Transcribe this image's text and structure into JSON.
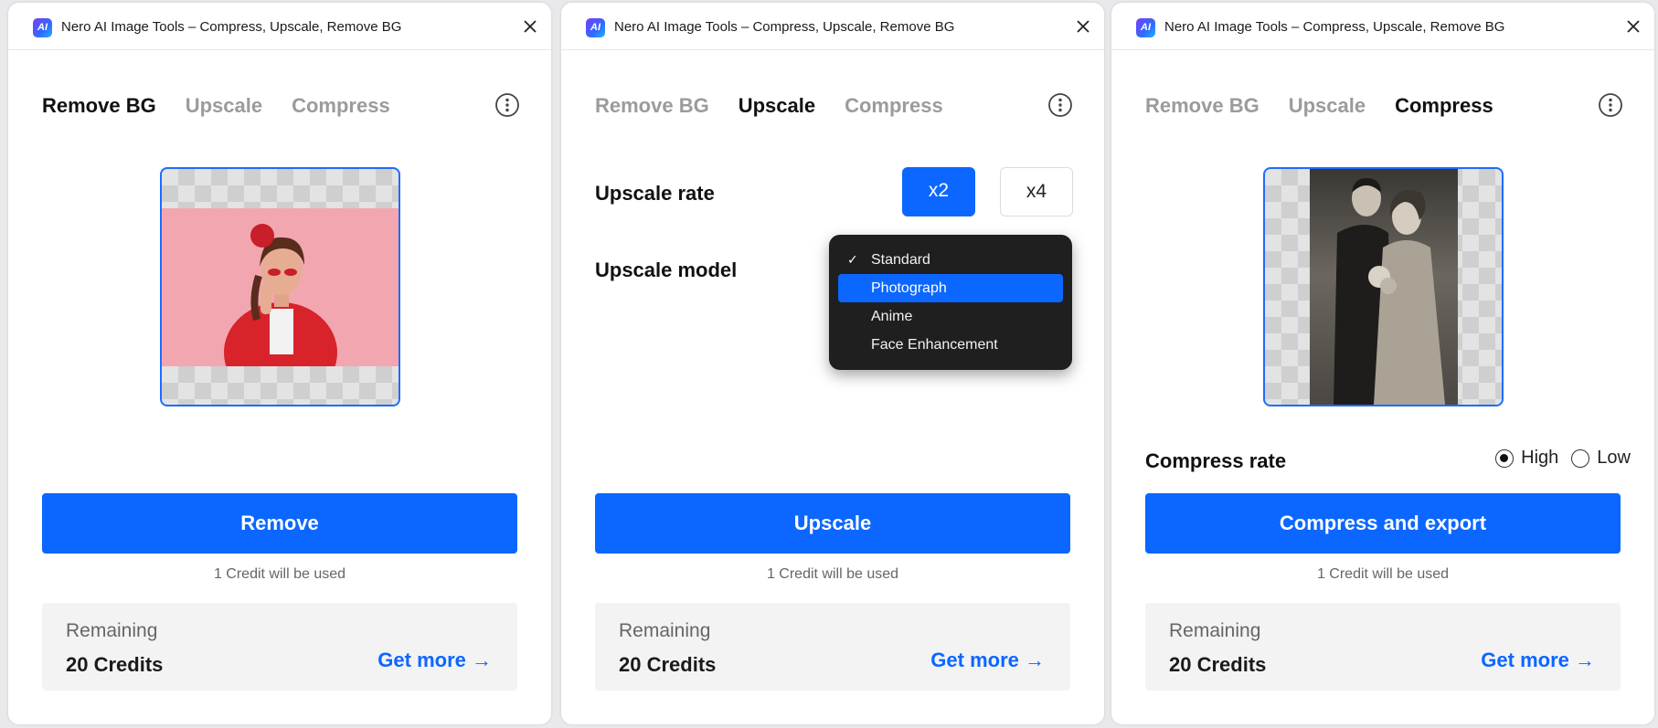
{
  "window": {
    "title": "Nero AI Image Tools – Compress, Upscale, Remove BG",
    "logo_text": "AI"
  },
  "tabs": {
    "remove_bg": "Remove BG",
    "upscale": "Upscale",
    "compress": "Compress"
  },
  "icons": {
    "close": "close-icon",
    "more": "more-vertical-icon",
    "check": "check-icon",
    "arrow": "arrow-right-icon"
  },
  "colors": {
    "accent": "#0b67ff",
    "dropdown_bg": "#1f1f1f",
    "active_tab": "#111111",
    "inactive_tab": "#9b9b9b"
  },
  "panels": {
    "remove_bg": {
      "active_tab": "Remove BG",
      "action_label": "Remove"
    },
    "upscale": {
      "active_tab": "Upscale",
      "rate_label": "Upscale rate",
      "rate_options": [
        "x2",
        "x4"
      ],
      "rate_selected": "x2",
      "model_label": "Upscale model",
      "model_options": [
        "Standard",
        "Photograph",
        "Anime",
        "Face Enhancement"
      ],
      "model_checked": "Standard",
      "model_highlighted": "Photograph",
      "action_label": "Upscale"
    },
    "compress": {
      "active_tab": "Compress",
      "rate_label": "Compress rate",
      "rate_options": [
        "High",
        "Low"
      ],
      "rate_selected": "High",
      "action_label": "Compress and export"
    }
  },
  "footer": {
    "credit_note": "1 Credit will be used",
    "remaining_label": "Remaining",
    "remaining_value": "20 Credits",
    "get_more_label": "Get more →"
  }
}
